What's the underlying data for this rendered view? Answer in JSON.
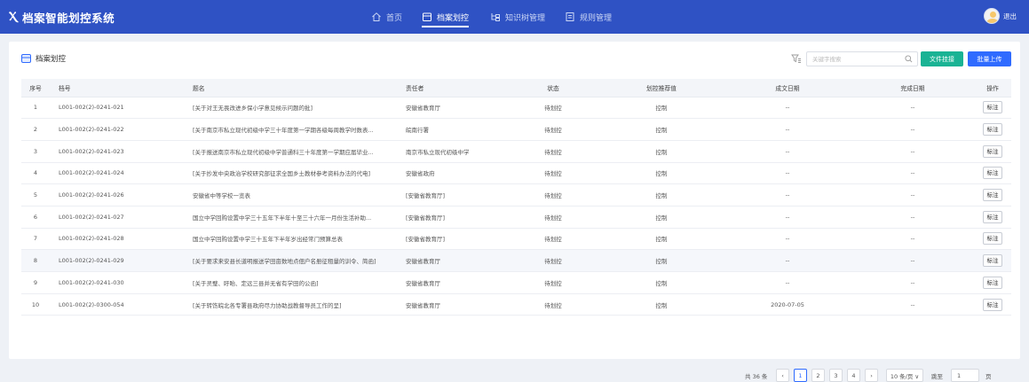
{
  "app": {
    "logo_glyph": "Ⲭ",
    "title": "档案智能划控系统",
    "logout": "退出"
  },
  "nav": [
    {
      "label": "首页",
      "icon": "home-icon"
    },
    {
      "label": "档案划控",
      "icon": "archive-icon",
      "active": true
    },
    {
      "label": "知识树管理",
      "icon": "tree-icon"
    },
    {
      "label": "规则管理",
      "icon": "rules-icon"
    }
  ],
  "page": {
    "title": "档案划控",
    "search_placeholder": "关键字搜索",
    "btn_attach": "文件挂接",
    "btn_upload": "批量上传"
  },
  "table": {
    "columns": [
      "序号",
      "档号",
      "题名",
      "责任者",
      "状态",
      "划控推荐值",
      "成文日期",
      "完成日期",
      "操作"
    ],
    "action_label": "标注",
    "rows": [
      {
        "no": "1",
        "code": "L001-002(2)-0241-021",
        "title": "[关于对王无畏改进乡保小学意见候示问题的批]",
        "owner": "安徽省教育厅",
        "status": "待划控",
        "rec": "控制",
        "date1": "--",
        "date2": "--"
      },
      {
        "no": "2",
        "code": "L001-002(2)-0241-022",
        "title": "[关于南京市私立现代初级中学三十年度第一学期各级每周教学时数表...",
        "owner": "皖南行署",
        "status": "待划控",
        "rec": "控制",
        "date1": "--",
        "date2": "--"
      },
      {
        "no": "3",
        "code": "L001-002(2)-0241-023",
        "title": "[关于报送南京市私立现代初级中学普通科三十年度第一学期应届毕业...",
        "owner": "南京市私立现代初级中学",
        "status": "待划控",
        "rec": "控制",
        "date1": "--",
        "date2": "--"
      },
      {
        "no": "4",
        "code": "L001-002(2)-0241-024",
        "title": "[关于抄发中央政治学校研究部征求全国乡土教材参考资料办法的代电]",
        "owner": "安徽省政府",
        "status": "待划控",
        "rec": "控制",
        "date1": "--",
        "date2": "--"
      },
      {
        "no": "5",
        "code": "L001-002(2)-0241-026",
        "title": "安徽省中等学校一览表",
        "owner": "[安徽省教育厅]",
        "status": "待划控",
        "rec": "控制",
        "date1": "--",
        "date2": "--"
      },
      {
        "no": "6",
        "code": "L001-002(2)-0241-027",
        "title": "国立中学回购设置中学三十五年下半年十至三十六年一月份生活补助...",
        "owner": "[安徽省教育厅]",
        "status": "待划控",
        "rec": "控制",
        "date1": "--",
        "date2": "--"
      },
      {
        "no": "7",
        "code": "L001-002(2)-0241-028",
        "title": "国立中学回购设置中学三十五年下半年岁出经常门预算总表",
        "owner": "[安徽省教育厅]",
        "status": "待划控",
        "rec": "控制",
        "date1": "--",
        "date2": "--"
      },
      {
        "no": "8",
        "code": "L001-002(2)-0241-029",
        "title": "[关于要求来安县长道明报送学田亩数地点佃户名册征租量的训令、简函]",
        "owner": "安徽省教育厅",
        "status": "待划控",
        "rec": "控制",
        "date1": "--",
        "date2": "--"
      },
      {
        "no": "9",
        "code": "L001-002(2)-0241-030",
        "title": "[关于灵璧、盱眙、定远三县并无省有学田的公函]",
        "owner": "安徽省教育厅",
        "status": "待划控",
        "rec": "控制",
        "date1": "--",
        "date2": "--"
      },
      {
        "no": "10",
        "code": "L001-002(2)-0300-054",
        "title": "[关于转饬皖北各专署县政府尽力协助战教督导员工作的呈]",
        "owner": "安徽省教育厅",
        "status": "待划控",
        "rec": "控制",
        "date1": "2020-07-05",
        "date2": "--"
      }
    ]
  },
  "pagination": {
    "total": "共 36 条",
    "prev": "‹",
    "pages": [
      "1",
      "2",
      "3",
      "4"
    ],
    "current": "1",
    "next": "›",
    "page_size": "10 条/页 ∨",
    "goto_label": "跳至",
    "goto_value": "1",
    "page_unit": "页"
  },
  "colors": {
    "header_bg": "#2f52c4",
    "attach_btn": "#1ab394",
    "upload_btn": "#2f6bff",
    "accent": "#2f6bff"
  }
}
